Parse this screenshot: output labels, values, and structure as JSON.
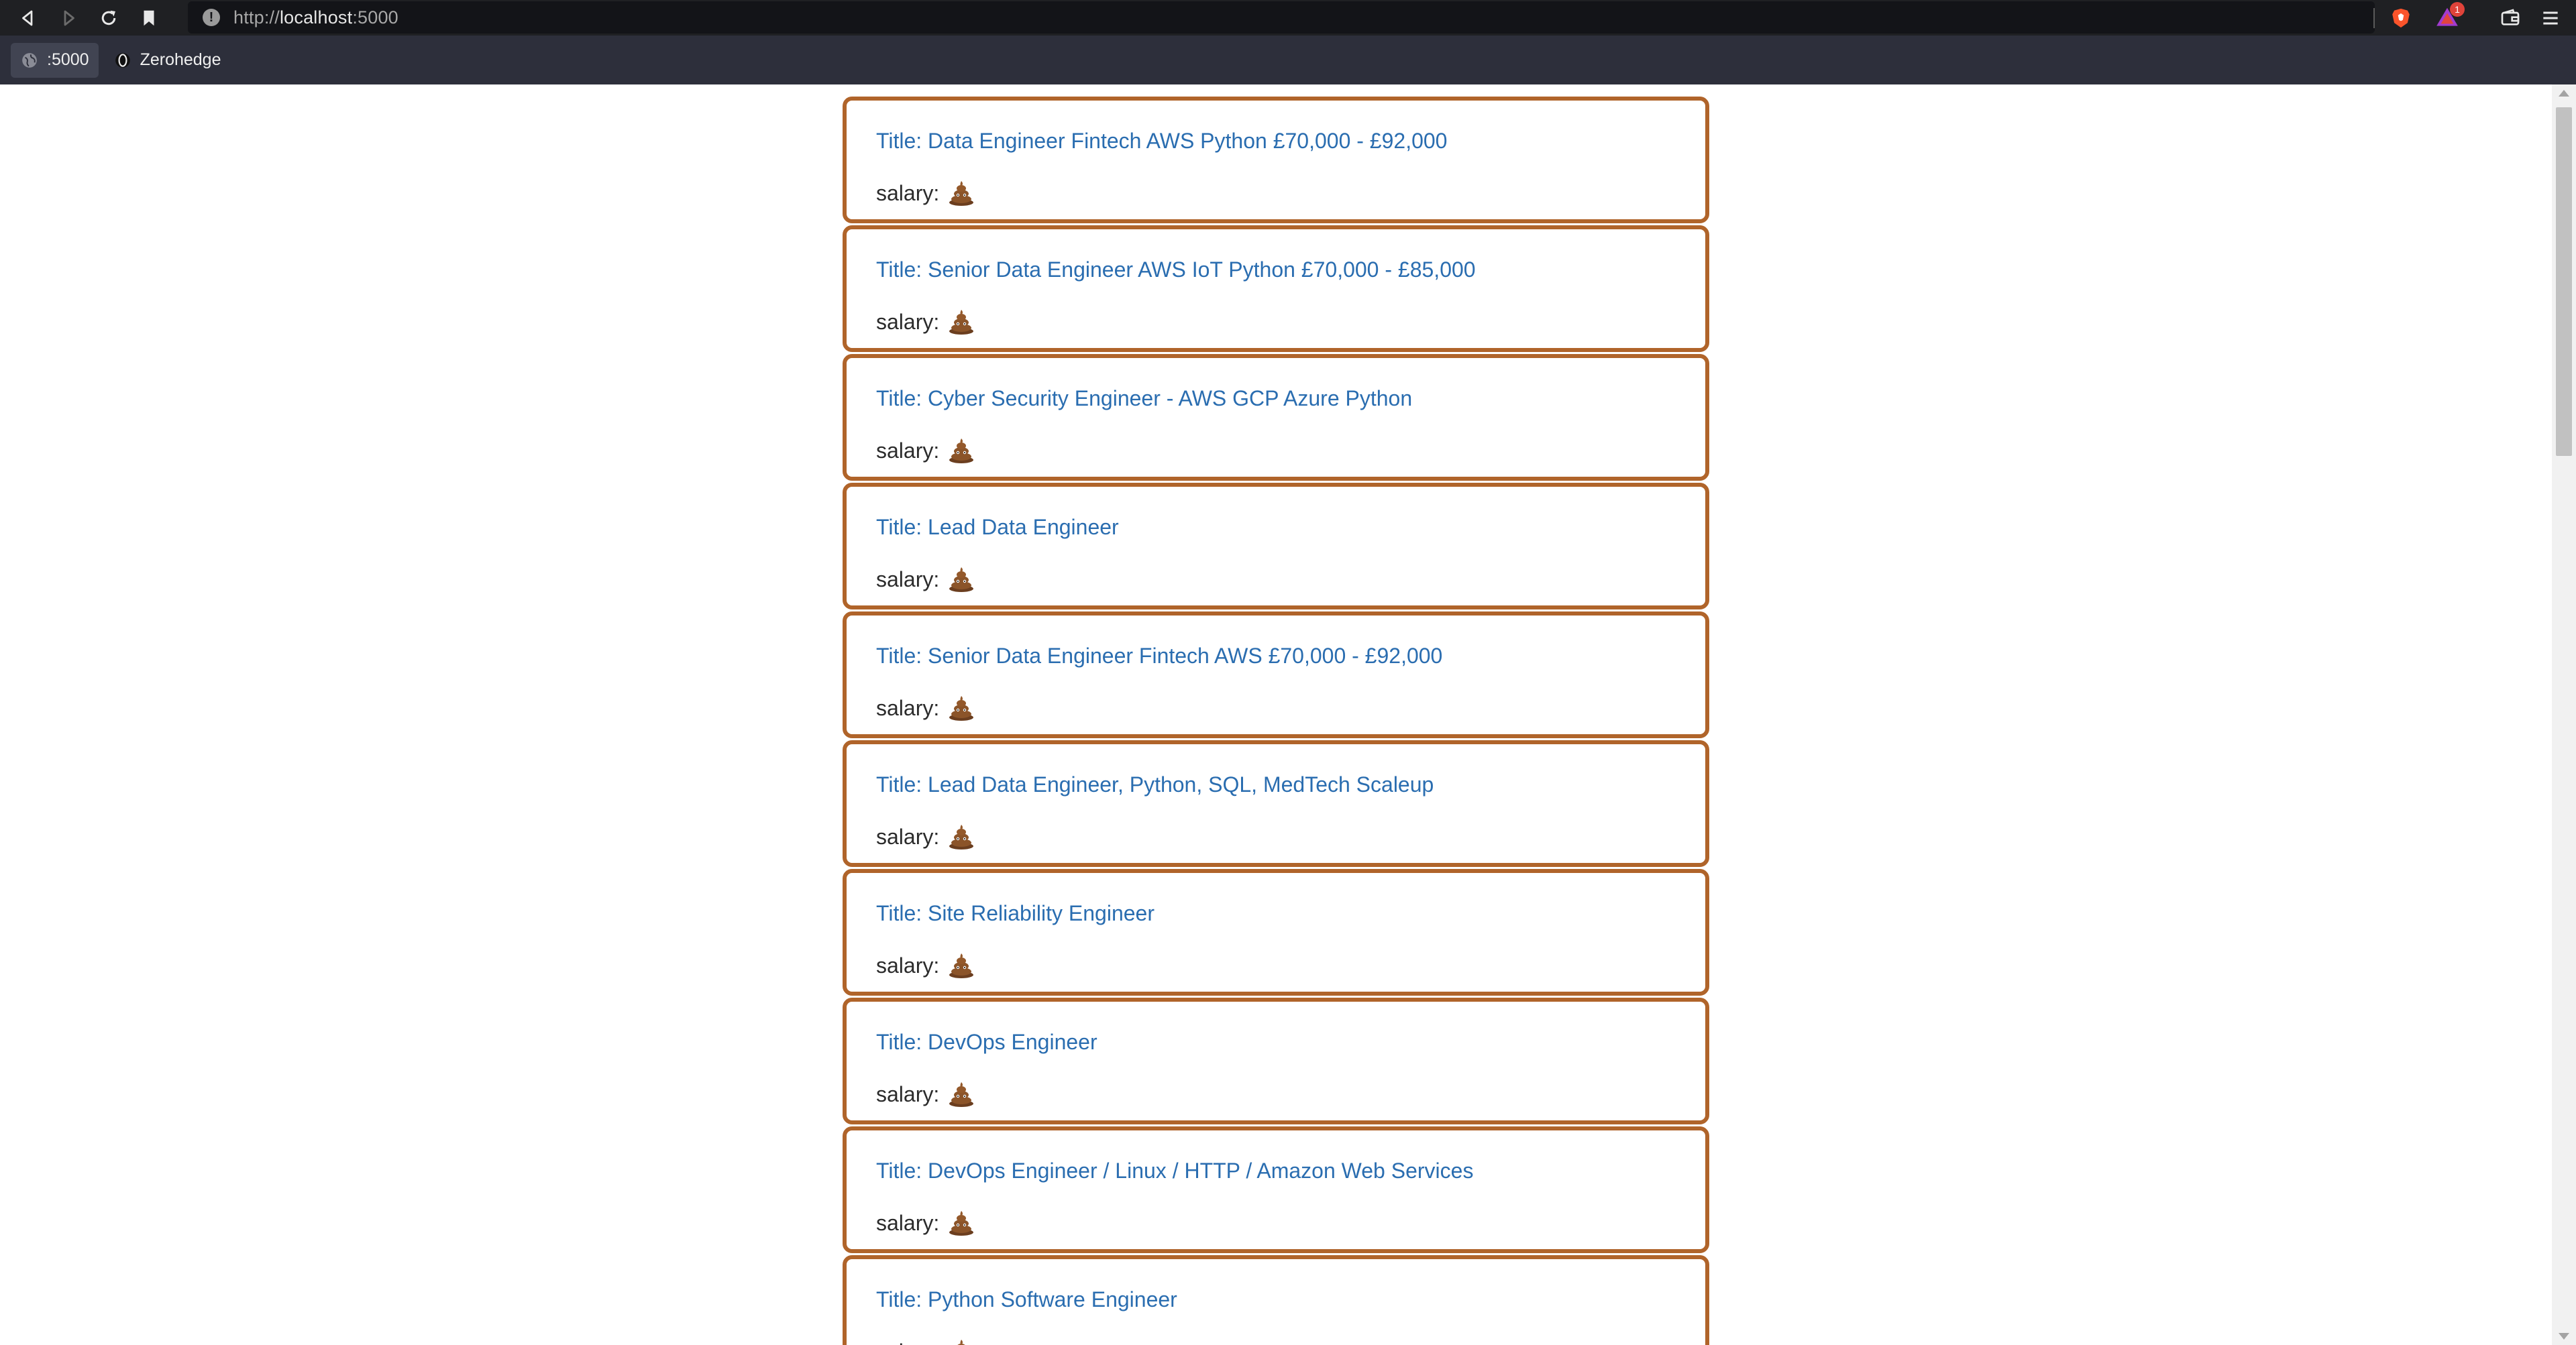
{
  "browser": {
    "url_scheme": "http://",
    "url_host": "localhost",
    "url_port": ":5000",
    "rewards_badge": "1"
  },
  "bookmarks": [
    {
      "label": ":5000"
    },
    {
      "label": "Zerohedge"
    }
  ],
  "jobs": [
    {
      "title": "Title: Data Engineer Fintech AWS Python £70,000 - £92,000",
      "salary_label": "salary:",
      "salary_icon": "poo-icon"
    },
    {
      "title": "Title: Senior Data Engineer AWS IoT Python £70,000 - £85,000",
      "salary_label": "salary:",
      "salary_icon": "poo-icon"
    },
    {
      "title": "Title: Cyber Security Engineer - AWS GCP Azure Python",
      "salary_label": "salary:",
      "salary_icon": "poo-icon"
    },
    {
      "title": "Title: Lead Data Engineer",
      "salary_label": "salary:",
      "salary_icon": "poo-icon"
    },
    {
      "title": "Title: Senior Data Engineer Fintech AWS £70,000 - £92,000",
      "salary_label": "salary:",
      "salary_icon": "poo-icon"
    },
    {
      "title": "Title: Lead Data Engineer, Python, SQL, MedTech Scaleup",
      "salary_label": "salary:",
      "salary_icon": "poo-icon"
    },
    {
      "title": "Title: Site Reliability Engineer",
      "salary_label": "salary:",
      "salary_icon": "poo-icon"
    },
    {
      "title": "Title: DevOps Engineer",
      "salary_label": "salary:",
      "salary_icon": "poo-icon"
    },
    {
      "title": "Title: DevOps Engineer / Linux / HTTP / Amazon Web Services",
      "salary_label": "salary:",
      "salary_icon": "poo-icon"
    },
    {
      "title": "Title: Python Software Engineer",
      "salary_label": "salary:",
      "salary_icon": "poo-icon"
    }
  ],
  "colors": {
    "card_border": "#b0642a",
    "title_link": "#2a6db0",
    "toolbar_bg": "#1f2023",
    "bookmarks_bg": "#2d2f3b"
  }
}
